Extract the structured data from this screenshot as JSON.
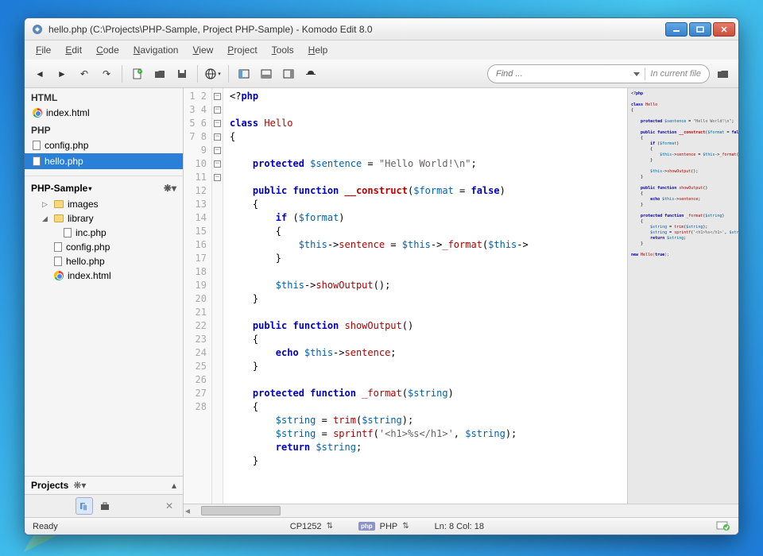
{
  "titlebar": {
    "text": "hello.php (C:\\Projects\\PHP-Sample, Project PHP-Sample) - Komodo Edit 8.0"
  },
  "menus": [
    "File",
    "Edit",
    "Code",
    "Navigation",
    "View",
    "Project",
    "Tools",
    "Help"
  ],
  "search": {
    "placeholder": "Find ...",
    "scope": "In current file"
  },
  "sidebar": {
    "groups": [
      {
        "label": "HTML",
        "items": [
          {
            "name": "index.html",
            "icon": "chrome",
            "selected": false
          }
        ]
      },
      {
        "label": "PHP",
        "items": [
          {
            "name": "config.php",
            "icon": "doc",
            "selected": false
          },
          {
            "name": "hello.php",
            "icon": "doc",
            "selected": true
          }
        ]
      }
    ],
    "project": {
      "name": "PHP-Sample",
      "tree": [
        {
          "name": "images",
          "type": "folder",
          "expanded": false,
          "depth": 1
        },
        {
          "name": "library",
          "type": "folder",
          "expanded": true,
          "depth": 1
        },
        {
          "name": "inc.php",
          "type": "doc",
          "depth": 2
        },
        {
          "name": "config.php",
          "type": "doc",
          "depth": 1
        },
        {
          "name": "hello.php",
          "type": "doc",
          "depth": 1
        },
        {
          "name": "index.html",
          "type": "chrome",
          "depth": 1
        }
      ]
    },
    "projects_label": "Projects"
  },
  "editor": {
    "filename": "hello.php",
    "visible_lines": {
      "first": 1,
      "last": 28
    },
    "code_lines": [
      [
        [
          "op",
          "<?"
        ],
        [
          "kw",
          "php"
        ]
      ],
      [],
      [
        [
          "kw",
          "class "
        ],
        [
          "cls",
          "Hello"
        ]
      ],
      [
        [
          "op",
          "{"
        ]
      ],
      [],
      [
        [
          "op",
          "    "
        ],
        [
          "kw",
          "protected "
        ],
        [
          "var",
          "$sentence"
        ],
        [
          "op",
          " = "
        ],
        [
          "str",
          "\"Hello World!\\n\""
        ],
        [
          "op",
          ";"
        ]
      ],
      [],
      [
        [
          "op",
          "    "
        ],
        [
          "kw",
          "public function "
        ],
        [
          "mg",
          "__construct"
        ],
        [
          "op",
          "("
        ],
        [
          "var",
          "$format"
        ],
        [
          "op",
          " = "
        ],
        [
          "kw",
          "false"
        ],
        [
          "op",
          ")"
        ]
      ],
      [
        [
          "op",
          "    {"
        ]
      ],
      [
        [
          "op",
          "        "
        ],
        [
          "kw",
          "if "
        ],
        [
          "op",
          "("
        ],
        [
          "var",
          "$format"
        ],
        [
          "op",
          ")"
        ]
      ],
      [
        [
          "op",
          "        {"
        ]
      ],
      [
        [
          "op",
          "            "
        ],
        [
          "var",
          "$this"
        ],
        [
          "op",
          "->"
        ],
        [
          "fn",
          "sentence"
        ],
        [
          "op",
          " = "
        ],
        [
          "var",
          "$this"
        ],
        [
          "op",
          "->"
        ],
        [
          "fn",
          "_format"
        ],
        [
          "op",
          "("
        ],
        [
          "var",
          "$this"
        ],
        [
          "op",
          "->"
        ]
      ],
      [
        [
          "op",
          "        }"
        ]
      ],
      [],
      [
        [
          "op",
          "        "
        ],
        [
          "var",
          "$this"
        ],
        [
          "op",
          "->"
        ],
        [
          "fn",
          "showOutput"
        ],
        [
          "op",
          "();"
        ]
      ],
      [
        [
          "op",
          "    }"
        ]
      ],
      [],
      [
        [
          "op",
          "    "
        ],
        [
          "kw",
          "public function "
        ],
        [
          "fn",
          "showOutput"
        ],
        [
          "op",
          "()"
        ]
      ],
      [
        [
          "op",
          "    {"
        ]
      ],
      [
        [
          "op",
          "        "
        ],
        [
          "kw",
          "echo "
        ],
        [
          "var",
          "$this"
        ],
        [
          "op",
          "->"
        ],
        [
          "fn",
          "sentence"
        ],
        [
          "op",
          ";"
        ]
      ],
      [
        [
          "op",
          "    }"
        ]
      ],
      [],
      [
        [
          "op",
          "    "
        ],
        [
          "kw",
          "protected function "
        ],
        [
          "fn",
          "_format"
        ],
        [
          "op",
          "("
        ],
        [
          "var",
          "$string"
        ],
        [
          "op",
          ")"
        ]
      ],
      [
        [
          "op",
          "    {"
        ]
      ],
      [
        [
          "op",
          "        "
        ],
        [
          "var",
          "$string"
        ],
        [
          "op",
          " = "
        ],
        [
          "fn",
          "trim"
        ],
        [
          "op",
          "("
        ],
        [
          "var",
          "$string"
        ],
        [
          "op",
          ");"
        ]
      ],
      [
        [
          "op",
          "        "
        ],
        [
          "var",
          "$string"
        ],
        [
          "op",
          " = "
        ],
        [
          "fn",
          "sprintf"
        ],
        [
          "op",
          "("
        ],
        [
          "str",
          "'<h1>%s</h1>'"
        ],
        [
          "op",
          ", "
        ],
        [
          "var",
          "$string"
        ],
        [
          "op",
          ");"
        ]
      ],
      [
        [
          "op",
          "        "
        ],
        [
          "kw",
          "return "
        ],
        [
          "var",
          "$string"
        ],
        [
          "op",
          ";"
        ]
      ],
      [
        [
          "op",
          "    }"
        ]
      ]
    ],
    "fold_marks": {
      "1": "-",
      "3": "-",
      "4": "-",
      "9": "-",
      "11": "-",
      "19": "-",
      "24": "-"
    }
  },
  "statusbar": {
    "status": "Ready",
    "encoding": "CP1252",
    "language": "PHP",
    "position": "Ln: 8 Col: 18"
  }
}
